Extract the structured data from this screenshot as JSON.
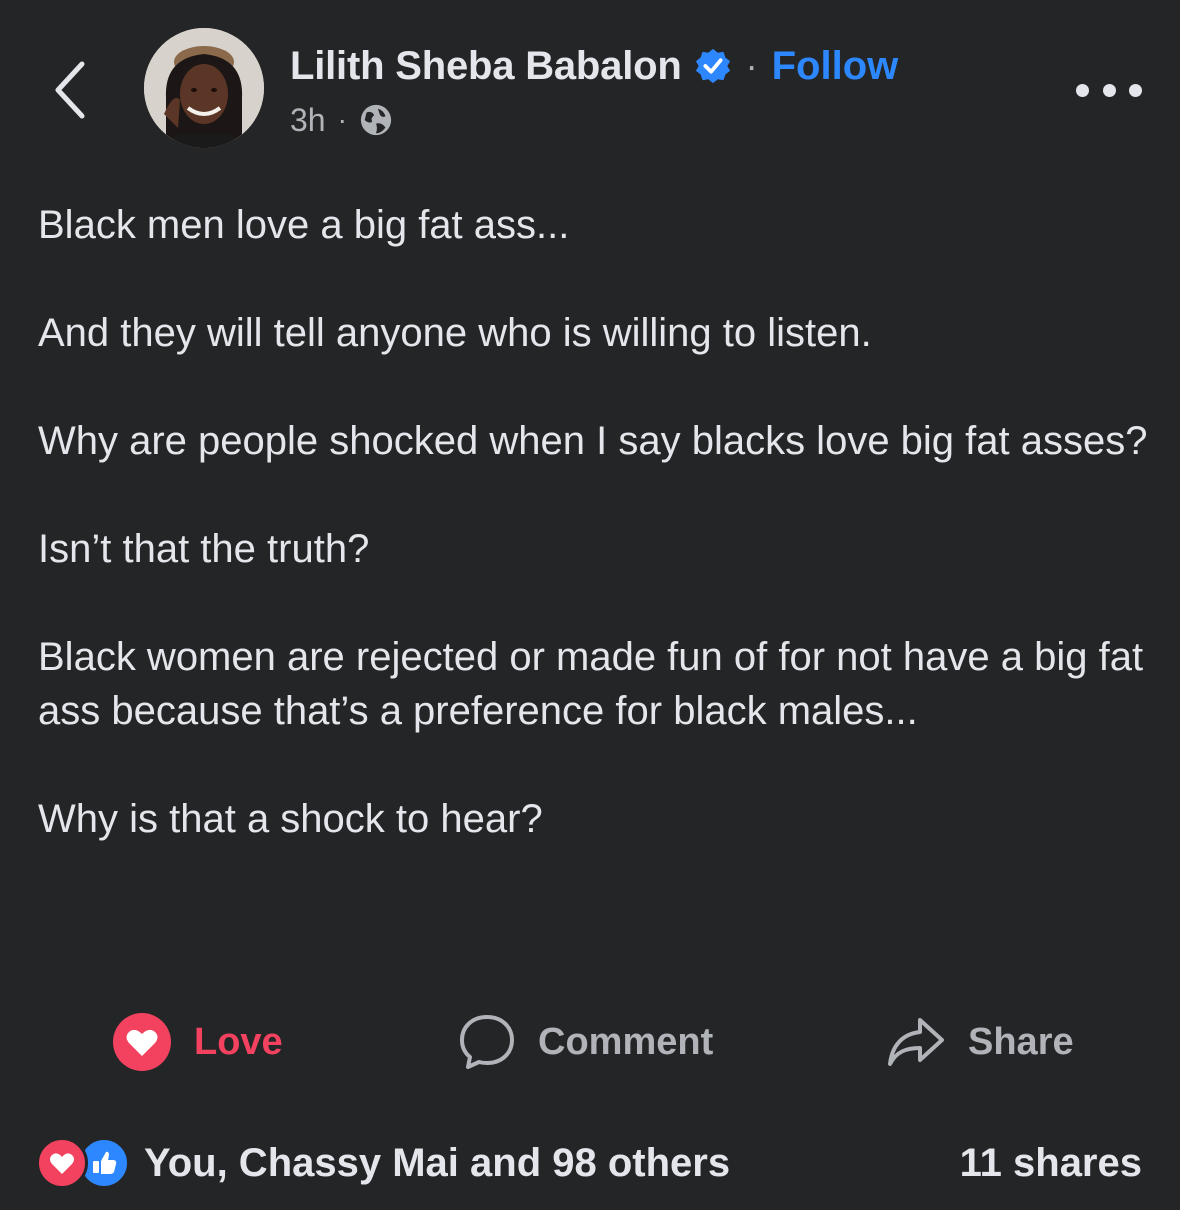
{
  "header": {
    "author_name": "Lilith Sheba Babalon",
    "separator": "·",
    "follow_label": "Follow",
    "timestamp": "3h",
    "meta_separator": "·",
    "icons": {
      "back": "chevron-left-icon",
      "verified": "verified-badge-icon",
      "privacy": "globe-icon",
      "more": "more-options-icon"
    }
  },
  "post": {
    "paragraphs": [
      "Black men love a big fat ass...",
      "And they will tell anyone who is willing to listen.",
      "Why are people shocked when I say blacks love big fat asses?",
      "Isn’t that the truth?",
      "Black women are rejected or made fun of for not have a big fat ass because that’s a preference for black males...",
      "Why is that a shock to hear?"
    ]
  },
  "actions": {
    "love_label": "Love",
    "comment_label": "Comment",
    "share_label": "Share"
  },
  "footer": {
    "reactions_text": "You, Chassy Mai and 98 others",
    "shares_text": "11 shares"
  },
  "colors": {
    "background": "#242526",
    "text_primary": "#e4e6eb",
    "text_secondary": "#b0b3b8",
    "accent_blue": "#2d88ff",
    "love_red": "#f3425f"
  }
}
